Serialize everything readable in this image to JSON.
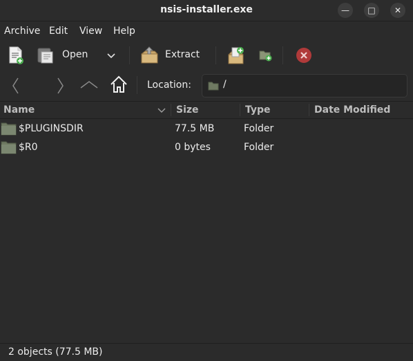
{
  "window": {
    "title": "nsis-installer.exe",
    "minimize_glyph": "—",
    "maximize_glyph": "□",
    "close_glyph": "✕"
  },
  "menu": [
    "Archive",
    "Edit",
    "View",
    "Help"
  ],
  "toolbar": {
    "open_label": "Open",
    "extract_label": "Extract"
  },
  "location": {
    "label": "Location:",
    "path": "/"
  },
  "columns": {
    "name": "Name",
    "size": "Size",
    "type": "Type",
    "date_modified": "Date Modified"
  },
  "files": [
    {
      "name": "$PLUGINSDIR",
      "size": "77.5 MB",
      "type": "Folder",
      "date_modified": ""
    },
    {
      "name": "$R0",
      "size": "0 bytes",
      "type": "Folder",
      "date_modified": ""
    }
  ],
  "status": {
    "text": "2 objects (77.5 MB)"
  },
  "colors": {
    "background": "#2b2b2b",
    "folder": "#6f7a62",
    "close_icon": "#c0392b",
    "add_green": "#4caf50"
  },
  "icons": {
    "new": "new-archive-icon",
    "open": "open-archive-icon",
    "extract": "extract-icon",
    "add_files": "add-files-icon",
    "add_folder": "add-folder-icon",
    "stop": "stop-icon",
    "back": "back-icon",
    "forward": "forward-icon",
    "up": "up-icon",
    "home": "home-icon",
    "folder": "folder-icon"
  }
}
